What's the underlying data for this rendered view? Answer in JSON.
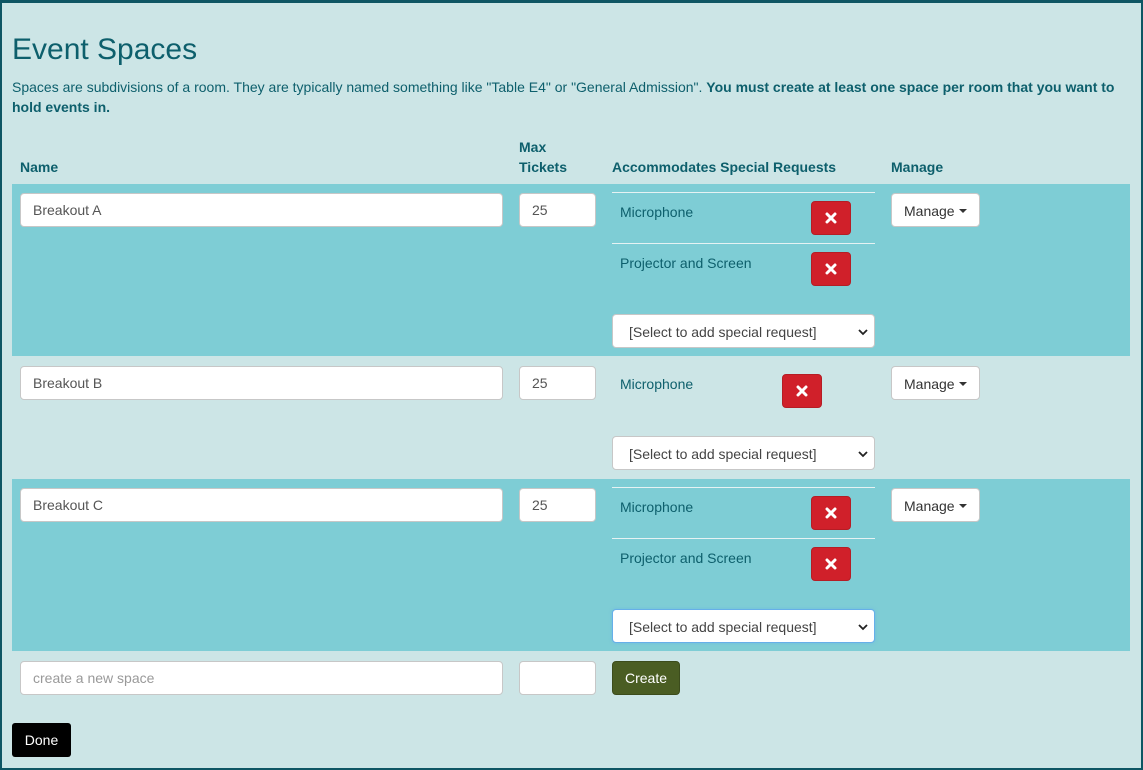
{
  "page": {
    "title": "Event Spaces",
    "description_plain": "Spaces are subdivisions of a room. They are typically named something like \"Table E4\" or \"General Admission\". ",
    "description_bold": "You must create at least one space per room that you want to hold events in."
  },
  "table": {
    "headers": {
      "name": "Name",
      "max_tickets_line1": "Max",
      "max_tickets_line2": "Tickets",
      "special_requests": "Accommodates Special Requests",
      "manage": "Manage"
    },
    "rows": [
      {
        "name": "Breakout A",
        "max_tickets": "25",
        "requests": [
          "Microphone",
          "Projector and Screen"
        ]
      },
      {
        "name": "Breakout B",
        "max_tickets": "25",
        "requests": [
          "Microphone"
        ]
      },
      {
        "name": "Breakout C",
        "max_tickets": "25",
        "requests": [
          "Microphone",
          "Projector and Screen"
        ]
      }
    ],
    "select_placeholder": "[Select to add special request]",
    "manage_label": "Manage"
  },
  "new_space": {
    "name_placeholder": "create a new space",
    "max_tickets_value": "",
    "create_label": "Create"
  },
  "footer": {
    "done_label": "Done"
  },
  "colors": {
    "background": "#cce5e6",
    "striped_row": "#7ecdd5",
    "heading_text": "#0d5f6c",
    "delete_button": "#d0202a",
    "create_button": "#4a5d23",
    "done_button": "#000000"
  },
  "icons": {
    "delete": "close-icon",
    "manage_caret": "caret-down-icon",
    "select_chevron": "chevron-down-icon"
  }
}
